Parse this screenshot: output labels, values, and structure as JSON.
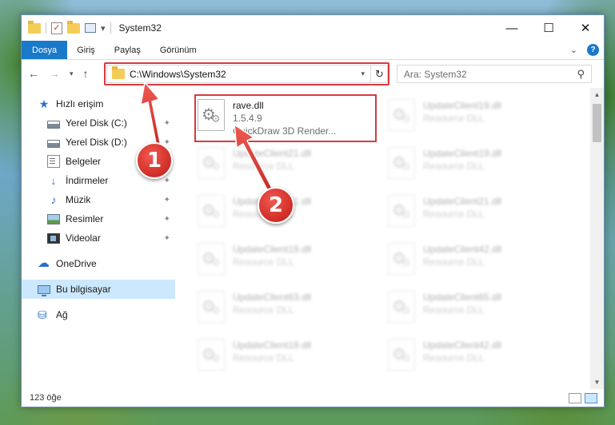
{
  "window": {
    "title": "System32"
  },
  "controls": {
    "minimize": "—",
    "maximize": "☐",
    "close": "✕"
  },
  "ribbon": {
    "tabs": [
      "Dosya",
      "Giriş",
      "Paylaş",
      "Görünüm"
    ],
    "help": "?",
    "expand": "⌄"
  },
  "address": {
    "path": "C:\\Windows\\System32",
    "dropdown": "▾",
    "refresh": "↻"
  },
  "search": {
    "placeholder": "Ara: System32"
  },
  "sidebar": {
    "quick_access": "Hızlı erişim",
    "items": [
      {
        "label": "Yerel Disk (C:)"
      },
      {
        "label": "Yerel Disk (D:)"
      },
      {
        "label": "Belgeler"
      },
      {
        "label": "İndirmeler"
      },
      {
        "label": "Müzik"
      },
      {
        "label": "Resimler"
      },
      {
        "label": "Videolar"
      }
    ],
    "onedrive": "OneDrive",
    "this_pc": "Bu bilgisayar",
    "network": "Ağ",
    "pin": "📌"
  },
  "files": {
    "highlighted": {
      "name": "rave.dll",
      "version": "1.5.4.9",
      "description": "QuickDraw 3D Render..."
    },
    "blurred": [
      {
        "name": "UpdateClient19.dll",
        "sub": "Resource DLL"
      },
      {
        "name": "UpdateClient21.dll",
        "sub": "Resource DLL"
      },
      {
        "name": "UpdateClient19.dll",
        "sub": "Resource DLL"
      },
      {
        "name": "UpdateClient21.dll",
        "sub": "Resource DLL"
      },
      {
        "name": "UpdateClient21.dll",
        "sub": "Resource DLL"
      },
      {
        "name": "UpdateClient19.dll",
        "sub": "Resource DLL"
      },
      {
        "name": "UpdateClient42.dll",
        "sub": "Resource DLL"
      },
      {
        "name": "UpdateClient63.dll",
        "sub": "Resource DLL"
      },
      {
        "name": "UpdateClient65.dll",
        "sub": "Resource DLL"
      },
      {
        "name": "UpdateClient19.dll",
        "sub": "Resource DLL"
      },
      {
        "name": "UpdateClient42.dll",
        "sub": "Resource DLL"
      }
    ]
  },
  "status": {
    "count": "123 öğe"
  },
  "annotations": {
    "step1": "1",
    "step2": "2",
    "color": "#d9393e"
  }
}
